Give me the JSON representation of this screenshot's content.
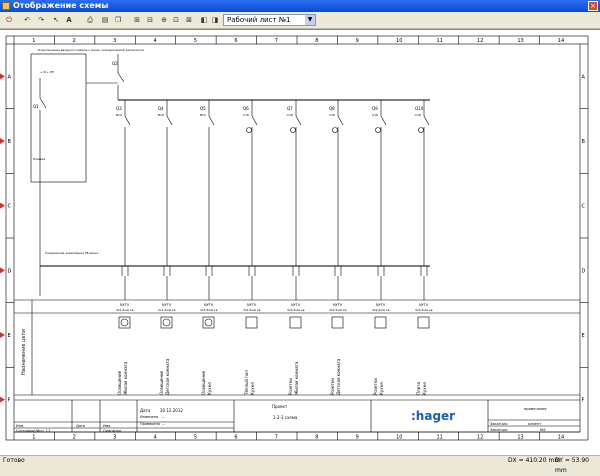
{
  "window": {
    "title": "Отображение схемы",
    "close": "×"
  },
  "toolbar": {
    "sheet_selector": "Рабочий лист №1"
  },
  "border": {
    "columns": [
      "1",
      "2",
      "3",
      "4",
      "5",
      "6",
      "7",
      "8",
      "9",
      "10",
      "11",
      "12",
      "13",
      "14"
    ],
    "rows": [
      "A",
      "B",
      "C",
      "D",
      "E",
      "F"
    ]
  },
  "supply": {
    "note": "Подключение вводного кабеля к шине, определяемой заказчиком",
    "text2": "+ N + PE",
    "q1": "Q1",
    "q2": "Q2",
    "klemma": "Клемма",
    "pe_note": "Соединение заземления РЕ шина"
  },
  "devices": [
    {
      "id": "Q3",
      "rating": "B10"
    },
    {
      "id": "Q4",
      "rating": "B16"
    },
    {
      "id": "Q5",
      "rating": "B10"
    },
    {
      "id": "Q6",
      "rating": "C16"
    },
    {
      "id": "Q7",
      "rating": "C16"
    },
    {
      "id": "Q8",
      "rating": "C16"
    },
    {
      "id": "Q9",
      "rating": "C16"
    },
    {
      "id": "Q10",
      "rating": "C16"
    }
  ],
  "cables": [
    {
      "type": "NYTV",
      "size": "3x1,5мм кв"
    },
    {
      "type": "NYTV",
      "size": "3x1,5мм кв"
    },
    {
      "type": "NYTV",
      "size": "3x1,5мм кв"
    },
    {
      "type": "NYTV",
      "size": "3x2,5мм кв"
    },
    {
      "type": "NYTV",
      "size": "3x2,5мм кв"
    },
    {
      "type": "NYTV",
      "size": "3x2,5мм кв"
    },
    {
      "type": "NYTV",
      "size": "3x2,5мм кв"
    },
    {
      "type": "NYTV",
      "size": "3x2,5мм кв"
    }
  ],
  "circuits_label": "Назначение цепи",
  "circuits": [
    {
      "line1": "Освещение",
      "line2": "Жилая комната"
    },
    {
      "line1": "Освещение",
      "line2": "Детская комната"
    },
    {
      "line1": "Освещение",
      "line2": "Кухня"
    },
    {
      "line1": "Тёплый пол",
      "line2": "Кухня"
    },
    {
      "line1": "Розетки",
      "line2": "Жилая комната"
    },
    {
      "line1": "Розетки",
      "line2": "Детская комната"
    },
    {
      "line1": "Розетки",
      "line2": "Кухня"
    },
    {
      "line1": "Плита",
      "line2": "Кухня"
    }
  ],
  "titleblock": {
    "date_label": "Дата",
    "date_value": "20.12.2012",
    "checked_label": "Изменено",
    "checked_value": "...",
    "approved_label": "Проверено",
    "approved_value": "...",
    "rev_label": "Изм.",
    "date2": "Дата",
    "name": "Имя",
    "state_label": "Состояние/Исп. 11",
    "original": "Оригинал",
    "project_label": "Проект",
    "scheme_name": "1-2-3 схема",
    "logo": ":hager",
    "remark": "примечание",
    "customer_label": "Заказчик:",
    "customer_value": "клиент",
    "order_label": "Заказчик:",
    "order_value": "№2"
  },
  "status": {
    "ready": "Готово",
    "dx": "DX = 410.20 mm",
    "dy": "DY = 53.90 mm"
  }
}
